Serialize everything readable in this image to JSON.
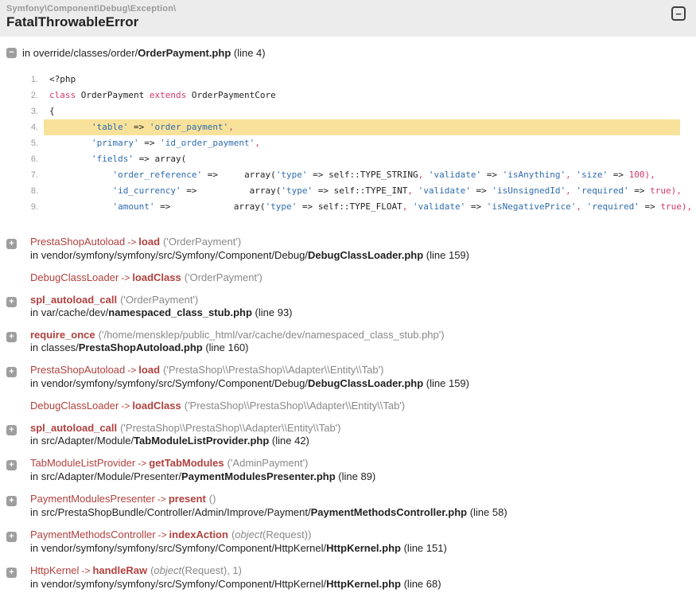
{
  "colors": {
    "header-bg": "#ececec",
    "trace-red": "#B0413E",
    "args-gray": "#888888",
    "def": "#222222",
    "str": "#2E6BAD",
    "kw": "#D4366E",
    "hl-bg": "#F8E29B",
    "icon-gray": "#9E9E9E"
  },
  "icons": {
    "plus": "+",
    "minus": "−",
    "collapse_all": "−"
  },
  "header": {
    "namespace": "Symfony\\Component\\Debug\\Exception\\",
    "title": "FatalThrowableError",
    "collapse_icon_symbol": "−"
  },
  "source": {
    "toggle_symbol": "−",
    "prefix": "in ",
    "path": "override/classes/order/",
    "file": "OrderPayment.php",
    "line_label": " (line 4)"
  },
  "code": {
    "highlight_line": 4,
    "lines": [
      {
        "n": 1,
        "tokens": [
          {
            "t": "<?php",
            "c": "def"
          }
        ]
      },
      {
        "n": 2,
        "tokens": [
          {
            "t": "class",
            "c": "kw"
          },
          {
            "t": " OrderPayment ",
            "c": "def"
          },
          {
            "t": "extends",
            "c": "kw"
          },
          {
            "t": " OrderPaymentCore",
            "c": "def"
          }
        ]
      },
      {
        "n": 3,
        "tokens": [
          {
            "t": "{",
            "c": "def"
          }
        ]
      },
      {
        "n": 4,
        "tokens": [
          {
            "t": "        ",
            "c": "def"
          },
          {
            "t": "'table'",
            "c": "str"
          },
          {
            "t": " => ",
            "c": "def"
          },
          {
            "t": "'order_payment'",
            "c": "str"
          },
          {
            "t": ",",
            "c": "kw"
          }
        ]
      },
      {
        "n": 5,
        "tokens": [
          {
            "t": "        ",
            "c": "def"
          },
          {
            "t": "'primary'",
            "c": "str"
          },
          {
            "t": " => ",
            "c": "def"
          },
          {
            "t": "'id_order_payment'",
            "c": "str"
          },
          {
            "t": ",",
            "c": "kw"
          }
        ]
      },
      {
        "n": 6,
        "tokens": [
          {
            "t": "        ",
            "c": "def"
          },
          {
            "t": "'fields'",
            "c": "str"
          },
          {
            "t": " => ",
            "c": "def"
          },
          {
            "t": "array(",
            "c": "def"
          }
        ]
      },
      {
        "n": 7,
        "tokens": [
          {
            "t": "            ",
            "c": "def"
          },
          {
            "t": "'order_reference'",
            "c": "str"
          },
          {
            "t": " =>     ",
            "c": "def"
          },
          {
            "t": "array(",
            "c": "def"
          },
          {
            "t": "'type'",
            "c": "str"
          },
          {
            "t": " => ",
            "c": "def"
          },
          {
            "t": "self::TYPE_STRING",
            "c": "def"
          },
          {
            "t": ", ",
            "c": "kw"
          },
          {
            "t": "'validate'",
            "c": "str"
          },
          {
            "t": " => ",
            "c": "def"
          },
          {
            "t": "'isAnything'",
            "c": "str"
          },
          {
            "t": ", ",
            "c": "kw"
          },
          {
            "t": "'size'",
            "c": "str"
          },
          {
            "t": " => ",
            "c": "def"
          },
          {
            "t": "100",
            "c": "kw"
          },
          {
            "t": "),",
            "c": "kw"
          }
        ]
      },
      {
        "n": 8,
        "tokens": [
          {
            "t": "            ",
            "c": "def"
          },
          {
            "t": "'id_currency'",
            "c": "str"
          },
          {
            "t": " =>          ",
            "c": "def"
          },
          {
            "t": "array(",
            "c": "def"
          },
          {
            "t": "'type'",
            "c": "str"
          },
          {
            "t": " => ",
            "c": "def"
          },
          {
            "t": "self::TYPE_INT",
            "c": "def"
          },
          {
            "t": ", ",
            "c": "kw"
          },
          {
            "t": "'validate'",
            "c": "str"
          },
          {
            "t": " => ",
            "c": "def"
          },
          {
            "t": "'isUnsignedId'",
            "c": "str"
          },
          {
            "t": ", ",
            "c": "kw"
          },
          {
            "t": "'required'",
            "c": "str"
          },
          {
            "t": " => ",
            "c": "def"
          },
          {
            "t": "true",
            "c": "kw"
          },
          {
            "t": "),",
            "c": "kw"
          }
        ]
      },
      {
        "n": 9,
        "tokens": [
          {
            "t": "            ",
            "c": "def"
          },
          {
            "t": "'amount'",
            "c": "str"
          },
          {
            "t": " =>            ",
            "c": "def"
          },
          {
            "t": "array(",
            "c": "def"
          },
          {
            "t": "'type'",
            "c": "str"
          },
          {
            "t": " => ",
            "c": "def"
          },
          {
            "t": "self::TYPE_FLOAT",
            "c": "def"
          },
          {
            "t": ", ",
            "c": "kw"
          },
          {
            "t": "'validate'",
            "c": "str"
          },
          {
            "t": " => ",
            "c": "def"
          },
          {
            "t": "'isNegativePrice'",
            "c": "str"
          },
          {
            "t": ", ",
            "c": "kw"
          },
          {
            "t": "'required'",
            "c": "str"
          },
          {
            "t": " => ",
            "c": "def"
          },
          {
            "t": "true",
            "c": "kw"
          },
          {
            "t": "),",
            "c": "kw"
          }
        ]
      }
    ]
  },
  "trace": {
    "entries": [
      {
        "icon": "plus",
        "class": "PrestaShopAutoload",
        "method": "load",
        "args": [
          {
            "t": "('OrderPayment')"
          }
        ],
        "location": {
          "prefix": "in vendor/symfony/symfony/src/Symfony/Component/Debug/",
          "file": "DebugClassLoader.php",
          "line": " (line 159)"
        }
      },
      {
        "icon": null,
        "class": "DebugClassLoader",
        "method": "loadClass",
        "args": [
          {
            "t": "('OrderPayment')"
          }
        ],
        "location": null
      },
      {
        "icon": "plus",
        "class": null,
        "method": "spl_autoload_call",
        "args": [
          {
            "t": "('OrderPayment')"
          }
        ],
        "location": {
          "prefix": "in var/cache/dev/",
          "file": "namespaced_class_stub.php",
          "line": " (line 93)"
        }
      },
      {
        "icon": "plus",
        "class": null,
        "method": "require_once",
        "args": [
          {
            "t": "('/home/mensklep/public_html/var/cache/dev/namespaced_class_stub.php')"
          }
        ],
        "location": {
          "prefix": "in classes/",
          "file": "PrestaShopAutoload.php",
          "line": " (line 160)"
        }
      },
      {
        "icon": "plus",
        "class": "PrestaShopAutoload",
        "method": "load",
        "args": [
          {
            "t": "('PrestaShop\\\\PrestaShop\\\\Adapter\\\\Entity\\\\Tab')"
          }
        ],
        "location": {
          "prefix": "in vendor/symfony/symfony/src/Symfony/Component/Debug/",
          "file": "DebugClassLoader.php",
          "line": " (line 159)"
        }
      },
      {
        "icon": null,
        "class": "DebugClassLoader",
        "method": "loadClass",
        "args": [
          {
            "t": "('PrestaShop\\\\PrestaShop\\\\Adapter\\\\Entity\\\\Tab')"
          }
        ],
        "location": null
      },
      {
        "icon": "plus",
        "class": null,
        "method": "spl_autoload_call",
        "args": [
          {
            "t": "('PrestaShop\\\\PrestaShop\\\\Adapter\\\\Entity\\\\Tab')"
          }
        ],
        "location": {
          "prefix": "in src/Adapter/Module/",
          "file": "TabModuleListProvider.php",
          "line": " (line 42)"
        }
      },
      {
        "icon": "plus",
        "class": "TabModuleListProvider",
        "method": "getTabModules",
        "args": [
          {
            "t": "('AdminPayment')"
          }
        ],
        "location": {
          "prefix": "in src/Adapter/Module/Presenter/",
          "file": "PaymentModulesPresenter.php",
          "line": " (line 89)"
        }
      },
      {
        "icon": "plus",
        "class": "PaymentModulesPresenter",
        "method": "present",
        "args": [
          {
            "t": "()"
          }
        ],
        "location": {
          "prefix": "in src/PrestaShopBundle/Controller/Admin/Improve/Payment/",
          "file": "PaymentMethodsController.php",
          "line": " (line 58)"
        }
      },
      {
        "icon": "plus",
        "class": "PaymentMethodsController",
        "method": "indexAction",
        "args": [
          {
            "t": "("
          },
          {
            "t": "object",
            "i": true
          },
          {
            "t": "(Request))"
          }
        ],
        "location": {
          "prefix": "in vendor/symfony/symfony/src/Symfony/Component/HttpKernel/",
          "file": "HttpKernel.php",
          "line": " (line 151)"
        }
      },
      {
        "icon": "plus",
        "class": "HttpKernel",
        "method": "handleRaw",
        "args": [
          {
            "t": "("
          },
          {
            "t": "object",
            "i": true
          },
          {
            "t": "(Request), 1)"
          }
        ],
        "location": {
          "prefix": "in vendor/symfony/symfony/src/Symfony/Component/HttpKernel/",
          "file": "HttpKernel.php",
          "line": " (line 68)"
        }
      }
    ]
  }
}
